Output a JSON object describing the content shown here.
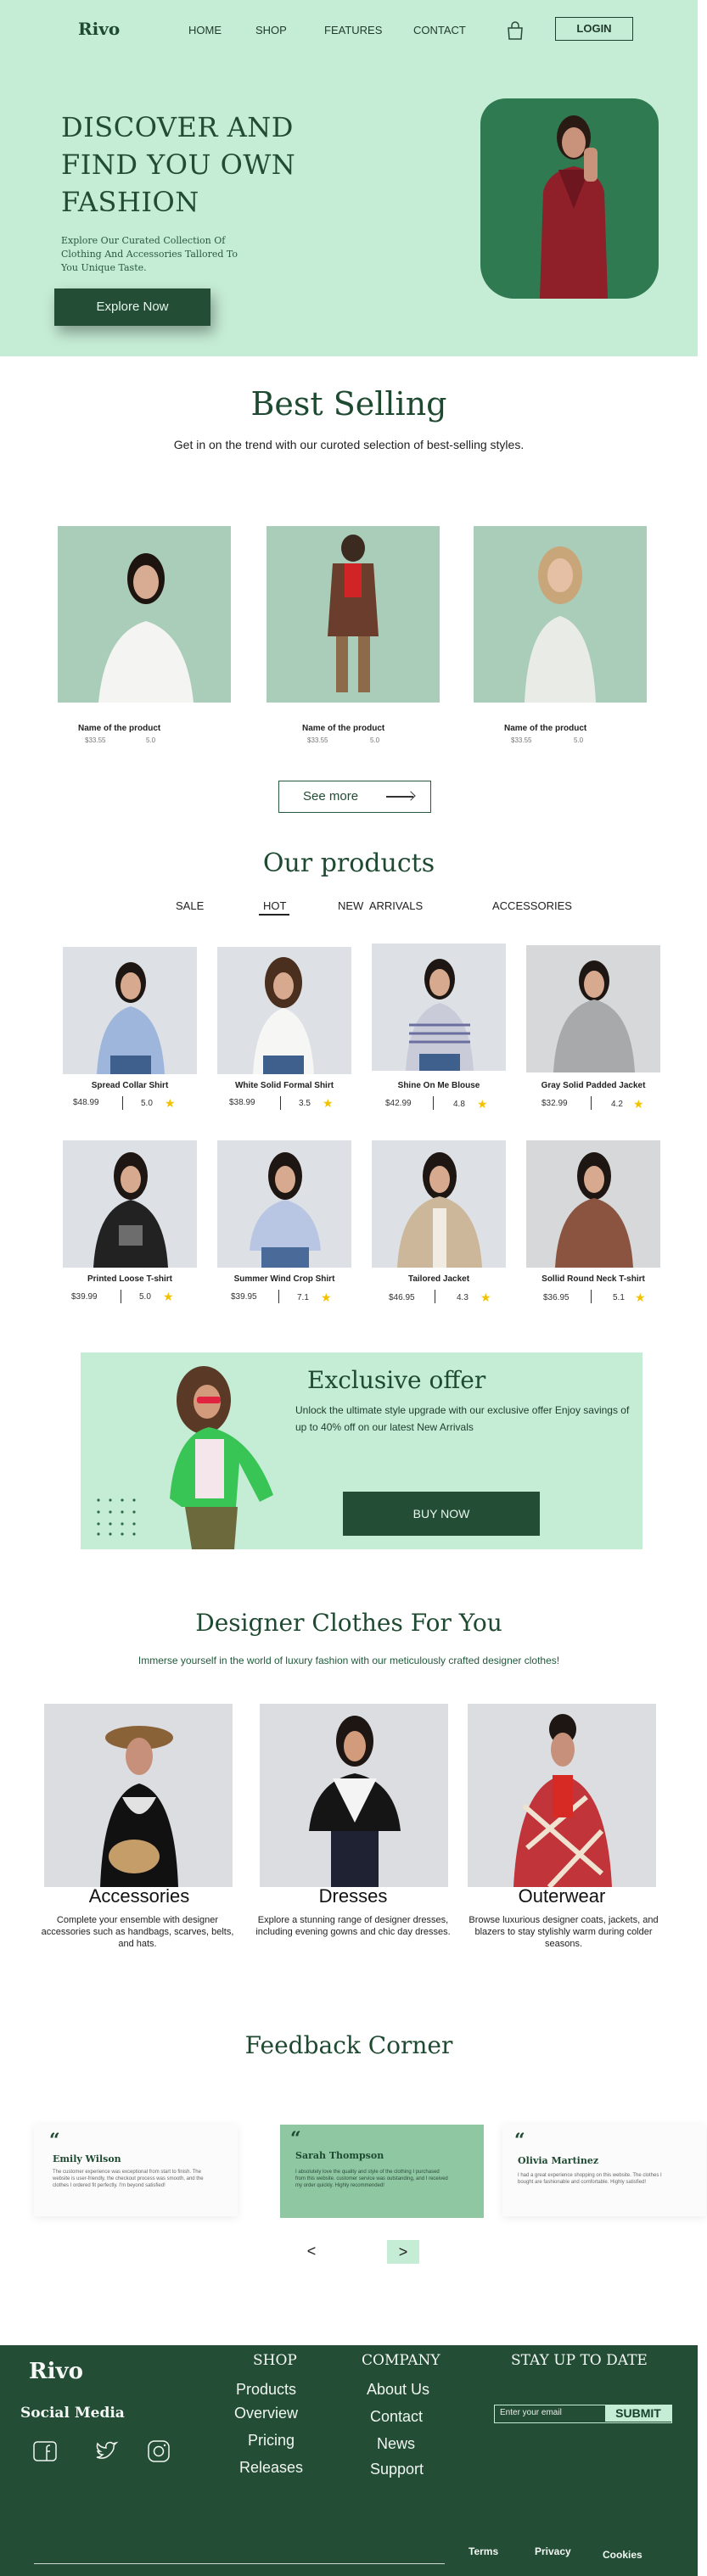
{
  "header": {
    "logo": "Rivo",
    "nav": [
      "HOME",
      "SHOP",
      "FEATURES",
      "CONTACT"
    ],
    "login": "LOGIN",
    "cart_icon": "shopping-bag-icon"
  },
  "hero": {
    "title": "DISCOVER AND FIND YOU OWN FASHION",
    "subtitle": "Explore Our Curated Collection Of Clothing And Accessories Tallored To You  Unique Taste.",
    "cta": "Explore Now",
    "bg_color": "#c5ecd4",
    "accent_color": "#234d35"
  },
  "best_selling": {
    "title": "Best Selling",
    "subtitle": "Get in on the trend with our curoted selection of best-selling styles.",
    "items": [
      {
        "name": "Name of the product",
        "price": "$33.55",
        "rating": "5.0"
      },
      {
        "name": "Name of the product",
        "price": "$33.55",
        "rating": "5.0"
      },
      {
        "name": "Name of the product",
        "price": "$33.55",
        "rating": "5.0"
      }
    ],
    "see_more": "See more"
  },
  "our_products": {
    "title": "Our products",
    "tabs": [
      "SALE",
      "HOT",
      "NEW  ARRIVALS",
      "ACCESSORIES"
    ],
    "active_tab": "HOT",
    "items": [
      {
        "name": "Spread Collar Shirt",
        "price": "$48.99",
        "rating": "5.0"
      },
      {
        "name": "White Solid Formal Shirt",
        "price": "$38.99",
        "rating": "3.5"
      },
      {
        "name": "Shine On Me Blouse",
        "price": "$42.99",
        "rating": "4.8"
      },
      {
        "name": "Gray Solid Padded Jacket",
        "price": "$32.99",
        "rating": "4.2"
      },
      {
        "name": "Printed Loose T-shirt",
        "price": "$39.99",
        "rating": "5.0"
      },
      {
        "name": "Summer Wind Crop Shirt",
        "price": "$39.95",
        "rating": "7.1"
      },
      {
        "name": "Tailored Jacket",
        "price": "$46.95",
        "rating": "4.3"
      },
      {
        "name": "Sollid Round Neck T-shirt",
        "price": "$36.95",
        "rating": "5.1"
      }
    ]
  },
  "offer": {
    "title": "Exclusive offer",
    "text": "Unlock the ultimate style upgrade with our exclusive offer Enjoy savings of up to 40% off on our latest New Arrivals",
    "cta": "BUY NOW"
  },
  "designer": {
    "title": "Designer Clothes For You",
    "subtitle": "Immerse yourself in the world of luxury fashion with our meticulously crafted designer clothes!",
    "cards": [
      {
        "title": "Accessories",
        "text": "Complete your ensemble with designer accessories such as handbags, scarves, belts, and hats."
      },
      {
        "title": "Dresses",
        "text": "Explore a stunning range of designer dresses, including evening gowns and chic day dresses."
      },
      {
        "title": "Outerwear",
        "text": "Browse luxurious designer coats, jackets, and blazers to stay stylishly warm during colder seasons."
      }
    ]
  },
  "feedback": {
    "title": "Feedback Corner",
    "items": [
      {
        "quote": "“",
        "name": "Emily Wilson",
        "text": "The customer experience was exceptional from start to finish. The website is user-friendly, the checkout process was smooth, and the clothes I ordered fit perfectly. I'm beyond satisfied!"
      },
      {
        "quote": "“",
        "name": "Sarah Thompson",
        "text": "I absolutely love the quality and style of the clothing I purchased from this website. customer service was outstanding, and I received my order quickly. Highly recommended!"
      },
      {
        "quote": "“",
        "name": "Olivia Martinez",
        "text": "I had a great experience shopping on this website. The clothes I bought are fashionable and comfortable. Highly satisfied!"
      }
    ],
    "prev": "<",
    "next": ">"
  },
  "footer": {
    "logo": "Rivo",
    "social_title": "Social Media",
    "social_icons": [
      "facebook-icon",
      "twitter-icon",
      "instagram-icon"
    ],
    "shop_title": "SHOP",
    "shop_links": [
      "Products",
      "Overview",
      "Pricing",
      "Releases"
    ],
    "company_title": "COMPANY",
    "company_links": [
      "About Us",
      "Contact",
      "News",
      "Support"
    ],
    "newsletter_title": "STAY UP TO DATE",
    "email_placeholder": "Enter your email",
    "submit": "SUBMIT",
    "bottom_links": [
      "Terms",
      "Privacy",
      "Cookies"
    ],
    "bg_color": "#234d35"
  }
}
